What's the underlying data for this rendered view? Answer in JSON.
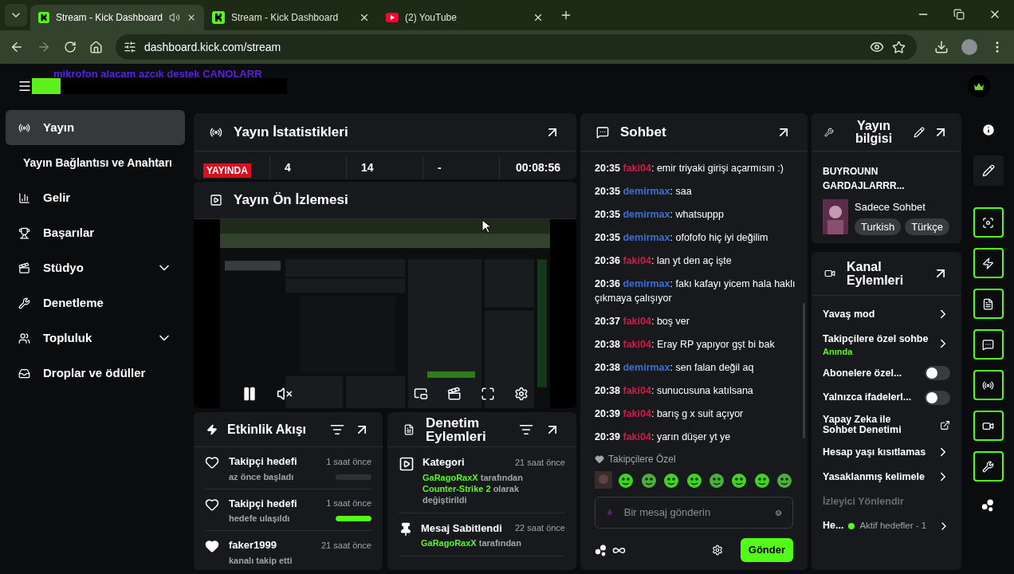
{
  "browser": {
    "tabs": [
      {
        "title": "Stream - Kick Dashboard",
        "kind": "kick",
        "selected": true,
        "audio": true
      },
      {
        "title": "Stream - Kick Dashboard",
        "kind": "kick",
        "selected": false,
        "audio": false
      },
      {
        "title": "(2) YouTube",
        "kind": "youtube",
        "selected": false,
        "audio": false
      }
    ],
    "url": "dashboard.kick.com/stream"
  },
  "header": {
    "overlay_text": "mikrofon alacam azcık destek CANOLARR"
  },
  "sidebar": {
    "items": [
      {
        "label": "Yayın",
        "kind": "link",
        "selected": true,
        "children": [
          {
            "label": "Yayın Bağlantısı ve Anahtarı",
            "selected": false
          }
        ]
      },
      {
        "label": "Gelir",
        "kind": "link",
        "selected": false
      },
      {
        "label": "Başarılar",
        "kind": "link",
        "selected": false
      },
      {
        "label": "Stüdyo",
        "kind": "group",
        "selected": false
      },
      {
        "label": "Denetleme",
        "kind": "link",
        "selected": false
      },
      {
        "label": "Topluluk",
        "kind": "group",
        "selected": false
      },
      {
        "label": "Droplar ve ödüller",
        "kind": "link",
        "selected": false
      }
    ]
  },
  "stats": {
    "title": "Yayın İstatistikleri",
    "status": "YAYINDA",
    "values": [
      "4",
      "14",
      "-",
      "00:08:56"
    ]
  },
  "preview": {
    "title": "Yayın Ön İzlemesi",
    "playing": true,
    "muted": true
  },
  "activity": {
    "title": "Etkinlik Akışı",
    "items": [
      {
        "title": "Takipçi hedefi",
        "time": "1 saat önce",
        "subtitle": "az önce başladı",
        "kind": "goal",
        "level": 0
      },
      {
        "title": "Takipçi hedefi",
        "time": "1 saat önce",
        "subtitle": "hedefe ulaşıldı",
        "kind": "goal",
        "level": 1
      },
      {
        "title": "faker1999",
        "time": "21 saat önce",
        "subtitle": "kanalı takip etti",
        "kind": "follow"
      }
    ]
  },
  "mod_actions": {
    "title": "Denetim Eylemleri",
    "items": [
      {
        "title": "Kategori",
        "time": "21 saat önce",
        "kind": "category",
        "parts": [
          {
            "text": "GaRagoRaxX",
            "highlight": true
          },
          {
            "text": " tarafından ",
            "highlight": false
          },
          {
            "text": "Counter-Strike 2",
            "highlight": true
          },
          {
            "text": " olarak değiştirildi",
            "highlight": false
          }
        ]
      },
      {
        "title": "Mesaj Sabitlendi",
        "time": "22 saat önce",
        "kind": "pin",
        "parts": [
          {
            "text": "GaRagoRaxX",
            "highlight": true
          },
          {
            "text": " tarafından",
            "highlight": false
          }
        ]
      }
    ]
  },
  "chat": {
    "title": "Sohbet",
    "separator": ": ",
    "messages": [
      {
        "time": "20:35",
        "user": "faki04",
        "color": "#d41a48",
        "text": "emir triyaki girişi açarmısın :)"
      },
      {
        "time": "20:35",
        "user": "demirmax",
        "color": "#3b6fd4",
        "text": "saa"
      },
      {
        "time": "20:35",
        "user": "demirmax",
        "color": "#3b6fd4",
        "text": "whatsuppp"
      },
      {
        "time": "20:35",
        "user": "demirmax",
        "color": "#3b6fd4",
        "text": "ofofofo hiç iyi değilim"
      },
      {
        "time": "20:36",
        "user": "faki04",
        "color": "#d41a48",
        "text": "lan yt den aç işte"
      },
      {
        "time": "20:36",
        "user": "demirmax",
        "color": "#3b6fd4",
        "text": "fakı kafayı yicem hala haklı çıkmaya çalışıyor"
      },
      {
        "time": "20:37",
        "user": "faki04",
        "color": "#d41a48",
        "text": "boş ver"
      },
      {
        "time": "20:38",
        "user": "faki04",
        "color": "#d41a48",
        "text": "Eray RP yapıyor gşt bi bak"
      },
      {
        "time": "20:38",
        "user": "demirmax",
        "color": "#3b6fd4",
        "text": "sen falan değil aq"
      },
      {
        "time": "20:38",
        "user": "faki04",
        "color": "#d41a48",
        "text": "sunucusuna katılsana"
      },
      {
        "time": "20:39",
        "user": "faki04",
        "color": "#d41a48",
        "text": "barış g x suit açıyor"
      },
      {
        "time": "20:39",
        "user": "faki04",
        "color": "#d41a48",
        "text": "yarın düşer yt ye"
      }
    ],
    "emote_label": "Takipçilere Özel",
    "placeholder": "Bir mesaj gönderin",
    "send": "Gönder"
  },
  "stream_info": {
    "title": "Yayın bilgisi",
    "stream_title": "BUYROUNN GARDAJLARRR...",
    "category": "Sadece Sohbet",
    "tags": [
      "Turkish",
      "Türkçe"
    ]
  },
  "channel_actions": {
    "title": "Kanal Eylemleri",
    "items": [
      {
        "label": "Yavaş mod",
        "kind": "link"
      },
      {
        "label": "Takipçilere özel sohbe",
        "kind": "link",
        "subtitle": "Anında"
      },
      {
        "label": "Abonelere özel...",
        "kind": "toggle",
        "on": false
      },
      {
        "label": "Yalnızca ifadelerl...",
        "kind": "toggle",
        "on": false
      },
      {
        "label": "Yapay Zeka ile Sohbet Denetimi",
        "kind": "external"
      },
      {
        "label": "Hesap yaşı kısıtlamas",
        "kind": "link"
      },
      {
        "label": "Yasaklanmış kelimele",
        "kind": "link"
      },
      {
        "label": "İzleyici Yönlendir",
        "kind": "section"
      },
      {
        "label": "He...",
        "kind": "status",
        "status": "Aktif hedefler - 1"
      }
    ]
  }
}
